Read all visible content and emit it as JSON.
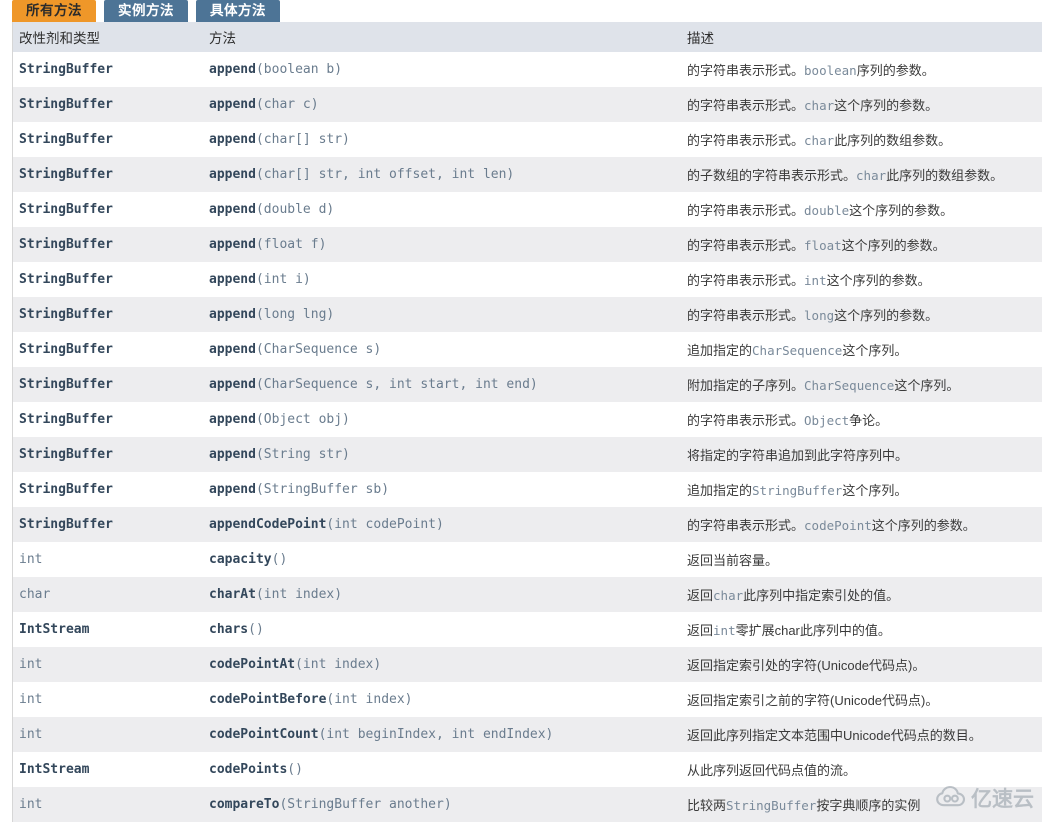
{
  "tabs": [
    {
      "label": "所有方法",
      "active": true
    },
    {
      "label": "实例方法",
      "active": false
    },
    {
      "label": "具体方法",
      "active": false
    }
  ],
  "table": {
    "columns": [
      "改性剂和类型",
      "方法",
      "描述"
    ],
    "rows": [
      {
        "modifier": "StringBuffer",
        "modifier_strong": true,
        "method_name": "append",
        "method_args": "(boolean b)",
        "desc_pre": "的字符串表示形式。",
        "desc_code": "boolean",
        "desc_post": "序列的参数。"
      },
      {
        "modifier": "StringBuffer",
        "modifier_strong": true,
        "method_name": "append",
        "method_args": "(char c)",
        "desc_pre": "的字符串表示形式。",
        "desc_code": "char",
        "desc_post": "这个序列的参数。"
      },
      {
        "modifier": "StringBuffer",
        "modifier_strong": true,
        "method_name": "append",
        "method_args": "(char[] str)",
        "desc_pre": "的字符串表示形式。",
        "desc_code": "char",
        "desc_post": "此序列的数组参数。"
      },
      {
        "modifier": "StringBuffer",
        "modifier_strong": true,
        "method_name": "append",
        "method_args": "(char[] str, int offset, int len)",
        "desc_pre": "的子数组的字符串表示形式。",
        "desc_code": "char",
        "desc_post": "此序列的数组参数。"
      },
      {
        "modifier": "StringBuffer",
        "modifier_strong": true,
        "method_name": "append",
        "method_args": "(double d)",
        "desc_pre": "的字符串表示形式。",
        "desc_code": "double",
        "desc_post": "这个序列的参数。"
      },
      {
        "modifier": "StringBuffer",
        "modifier_strong": true,
        "method_name": "append",
        "method_args": "(float f)",
        "desc_pre": "的字符串表示形式。",
        "desc_code": "float",
        "desc_post": "这个序列的参数。"
      },
      {
        "modifier": "StringBuffer",
        "modifier_strong": true,
        "method_name": "append",
        "method_args": "(int i)",
        "desc_pre": "的字符串表示形式。",
        "desc_code": "int",
        "desc_post": "这个序列的参数。"
      },
      {
        "modifier": "StringBuffer",
        "modifier_strong": true,
        "method_name": "append",
        "method_args": "(long lng)",
        "desc_pre": "的字符串表示形式。",
        "desc_code": "long",
        "desc_post": "这个序列的参数。"
      },
      {
        "modifier": "StringBuffer",
        "modifier_strong": true,
        "method_name": "append",
        "method_args": "(CharSequence s)",
        "desc_pre": "追加指定的",
        "desc_code": "CharSequence",
        "desc_post": "这个序列。"
      },
      {
        "modifier": "StringBuffer",
        "modifier_strong": true,
        "method_name": "append",
        "method_args": "(CharSequence s, int start, int end)",
        "desc_pre": "附加指定的子序列。",
        "desc_code": "CharSequence",
        "desc_post": "这个序列。"
      },
      {
        "modifier": "StringBuffer",
        "modifier_strong": true,
        "method_name": "append",
        "method_args": "(Object obj)",
        "desc_pre": "的字符串表示形式。",
        "desc_code": "Object",
        "desc_post": "争论。"
      },
      {
        "modifier": "StringBuffer",
        "modifier_strong": true,
        "method_name": "append",
        "method_args": "(String str)",
        "desc_pre": "将指定的字符串追加到此字符序列中。",
        "desc_code": "",
        "desc_post": ""
      },
      {
        "modifier": "StringBuffer",
        "modifier_strong": true,
        "method_name": "append",
        "method_args": "(StringBuffer sb)",
        "desc_pre": "追加指定的",
        "desc_code": "StringBuffer",
        "desc_post": "这个序列。"
      },
      {
        "modifier": "StringBuffer",
        "modifier_strong": true,
        "method_name": "appendCodePoint",
        "method_args": "(int codePoint)",
        "desc_pre": "的字符串表示形式。",
        "desc_code": "codePoint",
        "desc_post": "这个序列的参数。"
      },
      {
        "modifier": "int",
        "modifier_strong": false,
        "method_name": "capacity",
        "method_args": "()",
        "desc_pre": "返回当前容量。",
        "desc_code": "",
        "desc_post": ""
      },
      {
        "modifier": "char",
        "modifier_strong": false,
        "method_name": "charAt",
        "method_args": "(int index)",
        "desc_pre": "返回",
        "desc_code": "char",
        "desc_post": "此序列中指定索引处的值。"
      },
      {
        "modifier": "IntStream",
        "modifier_strong": true,
        "method_name": "chars",
        "method_args": "()",
        "desc_pre": "返回",
        "desc_code": "int",
        "desc_post": "零扩展char此序列中的值。"
      },
      {
        "modifier": "int",
        "modifier_strong": false,
        "method_name": "codePointAt",
        "method_args": "(int index)",
        "desc_pre": "返回指定索引处的字符(Unicode代码点)。",
        "desc_code": "",
        "desc_post": ""
      },
      {
        "modifier": "int",
        "modifier_strong": false,
        "method_name": "codePointBefore",
        "method_args": "(int index)",
        "desc_pre": "返回指定索引之前的字符(Unicode代码点)。",
        "desc_code": "",
        "desc_post": ""
      },
      {
        "modifier": "int",
        "modifier_strong": false,
        "method_name": "codePointCount",
        "method_args": "(int beginIndex, int endIndex)",
        "desc_pre": "返回此序列指定文本范围中Unicode代码点的数目。",
        "desc_code": "",
        "desc_post": ""
      },
      {
        "modifier": "IntStream",
        "modifier_strong": true,
        "method_name": "codePoints",
        "method_args": "()",
        "desc_pre": "从此序列返回代码点值的流。",
        "desc_code": "",
        "desc_post": ""
      },
      {
        "modifier": "int",
        "modifier_strong": false,
        "method_name": "compareTo",
        "method_args": "(StringBuffer another)",
        "desc_pre": "比较两",
        "desc_code": "StringBuffer",
        "desc_post": "按字典顺序的实例"
      }
    ]
  },
  "watermark": {
    "text": "亿速云",
    "icon": "cloud-icon"
  },
  "colors": {
    "tab_active": "#ef9729",
    "tab_inactive": "#4d7496",
    "header_bg": "#dfe3ea",
    "row_even_bg": "#ededef",
    "row_odd_bg": "#ffffff",
    "code_text": "#6a7c8e",
    "code_strong": "#33475b"
  }
}
